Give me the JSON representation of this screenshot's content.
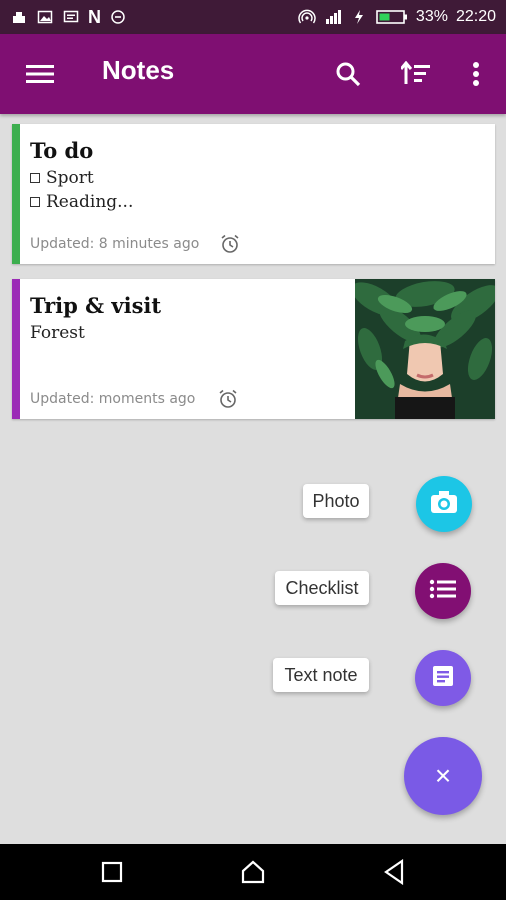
{
  "status_bar": {
    "battery": "33%",
    "time": "22:20",
    "left_icons": [
      "android-icon",
      "image-icon",
      "message-icon",
      "n-icon",
      "minus-circle-icon"
    ],
    "right_icons": [
      "hotspot-icon",
      "signal-icon",
      "charging-icon",
      "battery-icon"
    ],
    "n_label": "N"
  },
  "app_bar": {
    "title": "Notes",
    "icons": [
      "menu-icon",
      "search-icon",
      "sort-icon",
      "more-icon"
    ],
    "background": "#7f0f72"
  },
  "notes": [
    {
      "title": "To do",
      "color": "#3cae4e",
      "checklist": [
        "Sport",
        "Reading..."
      ],
      "updated": "Updated: 8 minutes ago"
    },
    {
      "title": "Trip & visit",
      "color": "#9b2ab6",
      "body": "Forest",
      "updated": "Updated: moments ago"
    }
  ],
  "fab_menu": {
    "photo_label": "Photo",
    "checklist_label": "Checklist",
    "text_note_label": "Text note",
    "close_label": "×",
    "photo_color": "#1cc6e6",
    "checklist_color": "#820f73",
    "text_note_color": "#7f5ae6",
    "main_color": "#7a5ae6"
  },
  "nav_bar": {
    "buttons": [
      "recents-button",
      "home-button",
      "back-button"
    ]
  }
}
